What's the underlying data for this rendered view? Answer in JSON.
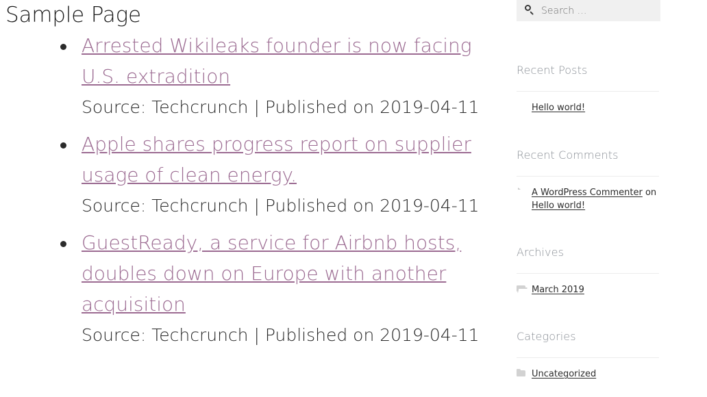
{
  "page": {
    "title": "Sample Page"
  },
  "posts": [
    {
      "title": "Arrested Wikileaks founder is now facing U.S. extradition",
      "meta": "Source: Techcrunch | Published on 2019-04-11"
    },
    {
      "title": "Apple shares progress report on supplier usage of clean energy.",
      "meta": "Source: Techcrunch | Published on 2019-04-11"
    },
    {
      "title": "GuestReady, a service for Airbnb hosts, doubles down on Europe with another acquisition",
      "meta": "Source: Techcrunch | Published on 2019-04-11"
    }
  ],
  "sidebar": {
    "search": {
      "placeholder": "Search …",
      "value": "",
      "icon": "search-icon"
    },
    "widgets": [
      {
        "title": "Recent Posts",
        "items": [
          {
            "icon": "document-icon",
            "link": "Hello world!"
          }
        ]
      },
      {
        "title": "Recent Comments",
        "items": [
          {
            "icon": "comment-icon",
            "link": "A WordPress Commenter",
            "connector": " on ",
            "link2": "Hello world!"
          }
        ]
      },
      {
        "title": "Archives",
        "items": [
          {
            "icon": "folder-open-icon",
            "link": "March 2019"
          }
        ]
      },
      {
        "title": "Categories",
        "items": [
          {
            "icon": "folder-closed-icon",
            "link": "Uncategorized"
          }
        ]
      }
    ]
  },
  "colors": {
    "link": "#9b6a91",
    "heading": "#8a8f96",
    "text": "#1a1a1a",
    "search_bg": "#f0f0f0",
    "divider": "#ececec"
  }
}
